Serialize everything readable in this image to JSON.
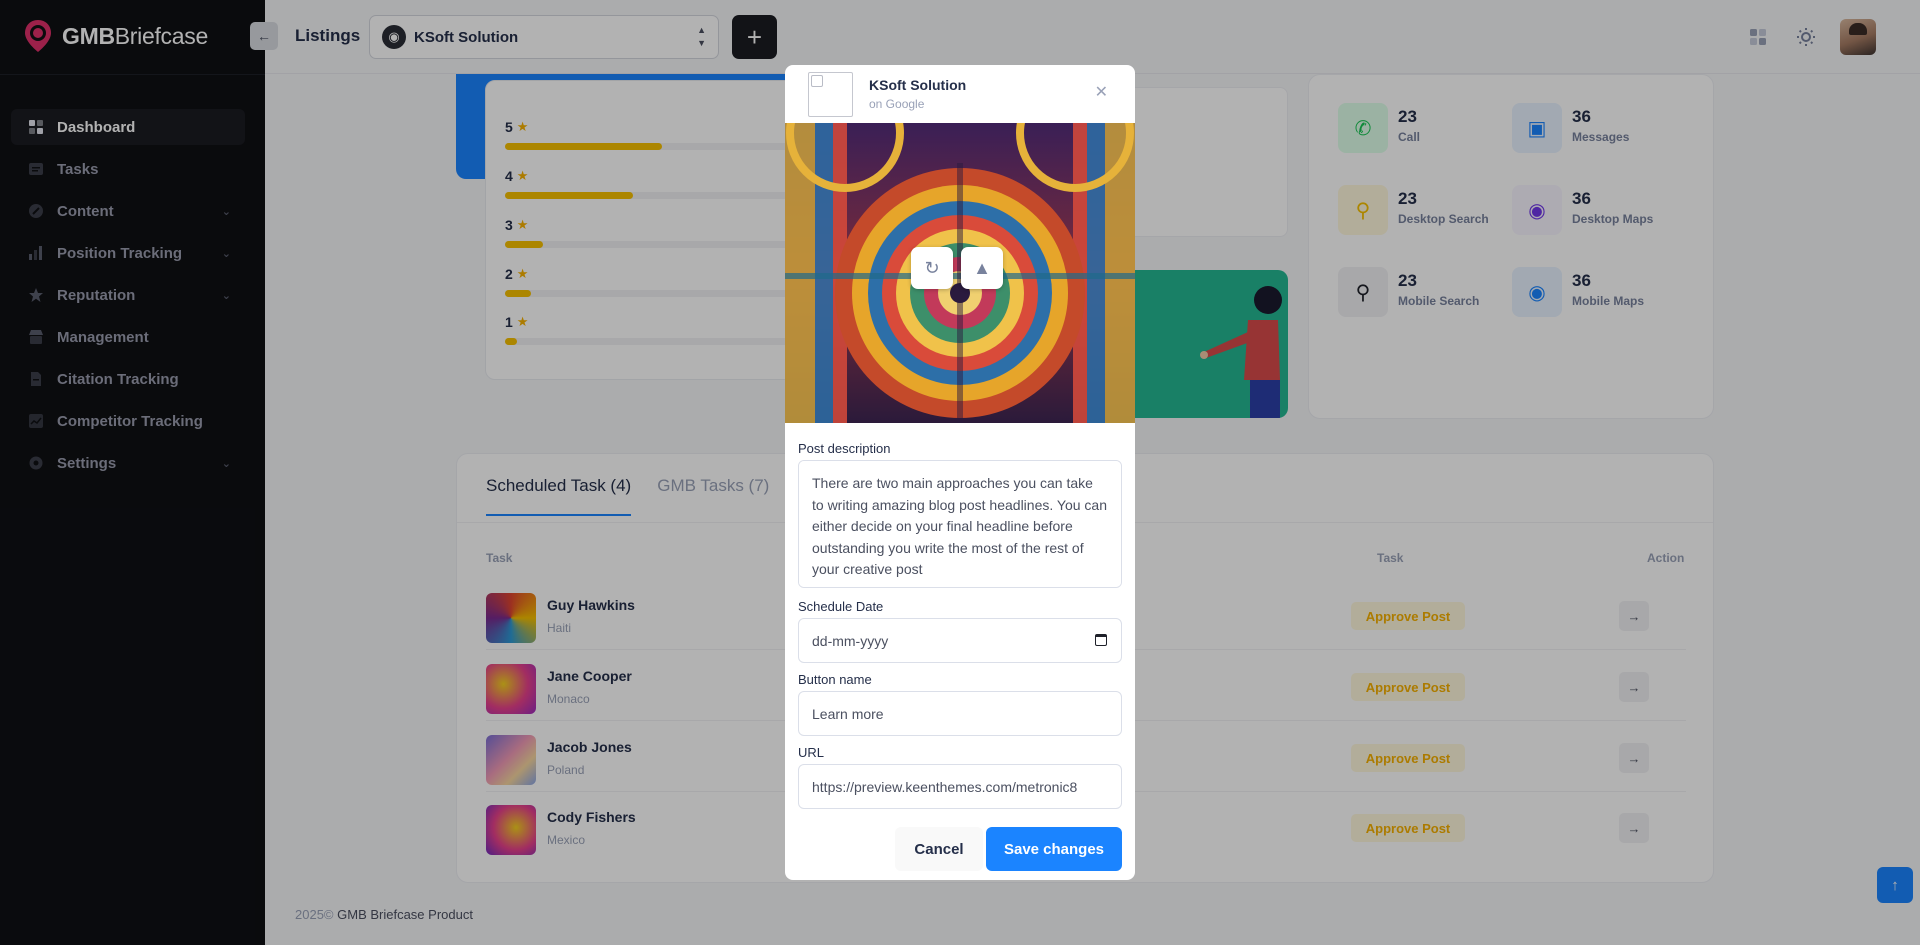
{
  "app": {
    "brand_bold": "GMB",
    "brand_light": "Briefcase"
  },
  "sidebar": {
    "items": [
      {
        "label": "Dashboard",
        "icon": "dashboard-icon",
        "active": true
      },
      {
        "label": "Tasks",
        "icon": "tasks-icon"
      },
      {
        "label": "Content",
        "icon": "content-icon",
        "has_children": true
      },
      {
        "label": "Position Tracking",
        "icon": "position-icon",
        "has_children": true
      },
      {
        "label": "Reputation",
        "icon": "star-icon",
        "has_children": true
      },
      {
        "label": "Management",
        "icon": "shop-icon"
      },
      {
        "label": "Citation Tracking",
        "icon": "document-icon"
      },
      {
        "label": "Competitor Tracking",
        "icon": "chart-icon"
      },
      {
        "label": "Settings",
        "icon": "gear-icon",
        "has_children": true
      }
    ]
  },
  "header": {
    "title": "Listings",
    "listing_selected": "KSoft Solution",
    "icons": [
      "grid-icon",
      "sun-icon",
      "avatar"
    ]
  },
  "ratings": [
    {
      "stars": "5",
      "fill": 0.54
    },
    {
      "stars": "4",
      "fill": 0.44
    },
    {
      "stars": "3",
      "fill": 0.13
    },
    {
      "stars": "2",
      "fill": 0.09
    },
    {
      "stars": "1",
      "fill": 0.04
    }
  ],
  "stats": [
    {
      "value": "23",
      "label": "Call",
      "icon": "phone-icon",
      "color": "#17c653"
    },
    {
      "value": "36",
      "label": "Messages",
      "icon": "message-icon",
      "color": "#1b84ff"
    },
    {
      "value": "23",
      "label": "Desktop Search",
      "icon": "search-icon",
      "color": "#f6c000"
    },
    {
      "value": "36",
      "label": "Desktop Maps",
      "icon": "map-pin-icon",
      "color": "#7239ea"
    },
    {
      "value": "23",
      "label": "Mobile Search",
      "icon": "search-icon",
      "color": "#1f212a"
    },
    {
      "value": "36",
      "label": "Mobile Maps",
      "icon": "map-pin-icon",
      "color": "#1b84ff"
    }
  ],
  "tasks": {
    "tabs": [
      {
        "label": "Scheduled Task (4)",
        "active": true
      },
      {
        "label": "GMB Tasks (7)",
        "active": false
      }
    ],
    "headers": {
      "task": "Task",
      "task2": "Task",
      "action": "Action"
    },
    "rows": [
      {
        "name": "Guy Hawkins",
        "location": "Haiti",
        "badge": "Approve Post"
      },
      {
        "name": "Jane Cooper",
        "location": "Monaco",
        "badge": "Approve Post"
      },
      {
        "name": "Jacob Jones",
        "location": "Poland",
        "badge": "Approve Post"
      },
      {
        "name": "Cody Fishers",
        "location": "Mexico",
        "badge": "Approve Post"
      }
    ]
  },
  "footer": {
    "year": "2025©",
    "product": "GMB Briefcase Product"
  },
  "modal": {
    "title": "KSoft Solution",
    "subtitle": "on Google",
    "description_label": "Post description",
    "description_value": "There are two main approaches you can take to writing amazing blog post headlines. You can either decide on your final headline before outstanding you write the most of the rest of your creative post",
    "schedule_label": "Schedule Date",
    "schedule_placeholder": "dd-mm-yyyy",
    "button_label": "Button name",
    "button_value": "Learn more",
    "url_label": "URL",
    "url_value": "https://preview.keenthemes.com/metronic8",
    "cancel": "Cancel",
    "save": "Save changes"
  },
  "colors": {
    "accent": "#1b84ff",
    "sidebar_bg": "#0f1014",
    "badge_text": "#f6b100",
    "badge_bg": "#fff8dd"
  }
}
